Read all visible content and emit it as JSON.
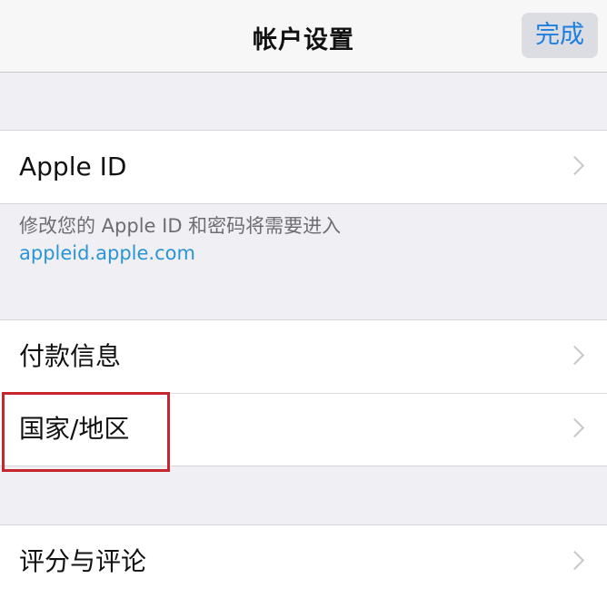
{
  "navbar": {
    "title": "帐户设置",
    "done_label": "完成",
    "accent_color": "#1d7fe0"
  },
  "apple_id_group": {
    "label": "Apple ID",
    "value": "",
    "chevron_icon": "chevron-right-icon"
  },
  "apple_id_footer": {
    "text": "修改您的 Apple ID 和密码将需要进入",
    "link": "appleid.apple.com"
  },
  "account_group": {
    "items": [
      {
        "label": "付款信息",
        "icon": "chevron-right-icon"
      },
      {
        "label": "国家/地区",
        "icon": "chevron-right-icon",
        "highlighted": true
      }
    ]
  },
  "ratings_group": {
    "items": [
      {
        "label": "评分与评论",
        "icon": "chevron-right-icon"
      }
    ]
  },
  "highlight": {
    "target": "国家/地区",
    "color": "#c8262e"
  }
}
